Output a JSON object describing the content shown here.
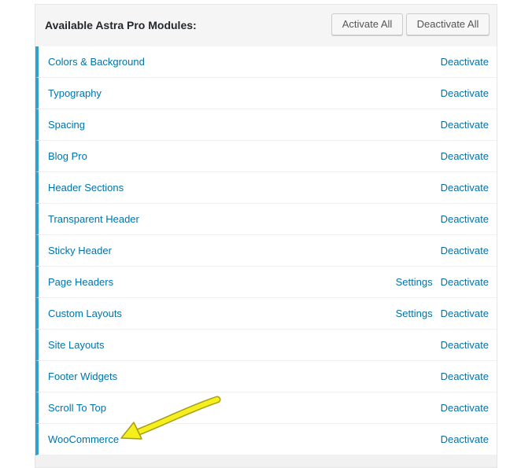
{
  "header": {
    "title": "Available Astra Pro Modules:",
    "activate_all_label": "Activate All",
    "deactivate_all_label": "Deactivate All"
  },
  "modules": [
    {
      "name": "Colors & Background",
      "settings": "",
      "action": "Deactivate"
    },
    {
      "name": "Typography",
      "settings": "",
      "action": "Deactivate"
    },
    {
      "name": "Spacing",
      "settings": "",
      "action": "Deactivate"
    },
    {
      "name": "Blog Pro",
      "settings": "",
      "action": "Deactivate"
    },
    {
      "name": "Header Sections",
      "settings": "",
      "action": "Deactivate"
    },
    {
      "name": "Transparent Header",
      "settings": "",
      "action": "Deactivate"
    },
    {
      "name": "Sticky Header",
      "settings": "",
      "action": "Deactivate"
    },
    {
      "name": "Page Headers",
      "settings": "Settings",
      "action": "Deactivate"
    },
    {
      "name": "Custom Layouts",
      "settings": "Settings",
      "action": "Deactivate"
    },
    {
      "name": "Site Layouts",
      "settings": "",
      "action": "Deactivate"
    },
    {
      "name": "Footer Widgets",
      "settings": "",
      "action": "Deactivate"
    },
    {
      "name": "Scroll To Top",
      "settings": "",
      "action": "Deactivate"
    },
    {
      "name": "WooCommerce",
      "settings": "",
      "action": "Deactivate"
    }
  ],
  "annotation": {
    "arrow_color": "#f5ef1e",
    "arrow_outline_color": "#a79d12",
    "target": "WooCommerce"
  },
  "colors": {
    "link": "#0073aa",
    "active_border": "#2ea2cc"
  }
}
